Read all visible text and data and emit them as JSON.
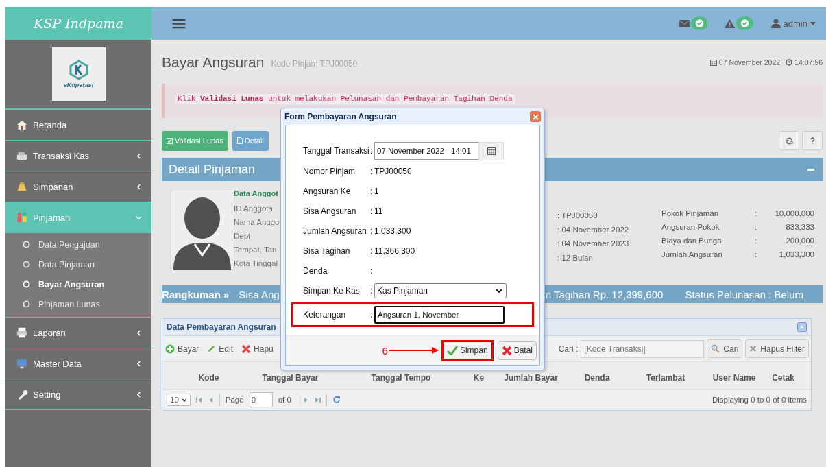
{
  "brand": "KSP Indpama",
  "logo_text": "eKoperasi",
  "topbar": {
    "user": "admin"
  },
  "sidebar": {
    "items": [
      {
        "label": "Beranda",
        "kind": "link",
        "selected": false
      },
      {
        "label": "Transaksi Kas",
        "kind": "menu",
        "selected": false,
        "expanded": false
      },
      {
        "label": "Simpanan",
        "kind": "menu",
        "selected": false,
        "expanded": false
      },
      {
        "label": "Pinjaman",
        "kind": "menu",
        "selected": true,
        "expanded": true,
        "children": [
          {
            "label": "Data Pengajuan",
            "selected": false
          },
          {
            "label": "Data Pinjaman",
            "selected": false
          },
          {
            "label": "Bayar Angsuran",
            "selected": true
          },
          {
            "label": "Pinjaman Lunas",
            "selected": false
          }
        ]
      },
      {
        "label": "Laporan",
        "kind": "menu",
        "selected": false,
        "expanded": false
      },
      {
        "label": "Master Data",
        "kind": "menu",
        "selected": false,
        "expanded": false
      },
      {
        "label": "Setting",
        "kind": "menu",
        "selected": false,
        "expanded": false
      }
    ]
  },
  "page": {
    "title": "Bayar Angsuran",
    "subtitle": "Kode Pinjam TPJ00050",
    "date": "07 November 2022",
    "time": "14:07:56"
  },
  "alert": "Klik **Validasi Lunas** untuk melakukan Pelunasan dan Pembayaran Tagihan Denda",
  "actions": [
    {
      "label": "Validasi Lunas",
      "kind": "success"
    },
    {
      "label": "Detail",
      "kind": "info"
    }
  ],
  "detail": {
    "title": "Detail Pinjaman",
    "member_heading": "Data Anggot",
    "member_labels": [
      "ID Anggota",
      "Nama Anggo",
      "Dept",
      "Tempat, Tan",
      "Kota Tinggal"
    ],
    "loan_values": [
      ": TPJ00050",
      ": 04 November 2022",
      ": 04 November 2023",
      ": 12 Bulan"
    ],
    "amounts": [
      {
        "label": "Pokok Pinjaman",
        "separator": ":",
        "value": "10,000,000"
      },
      {
        "label": "Angsuran Pokok",
        "separator": ":",
        "value": "833,333"
      },
      {
        "label": "Biaya dan Bunga",
        "separator": ":",
        "value": "200,000"
      },
      {
        "label": "Jumlah Angsuran",
        "separator": ":",
        "value": "1,033,300"
      }
    ],
    "summary": {
      "heading": "Rangkuman »",
      "left": "Sisa Ang",
      "right": "n Tagihan Rp. 12,399,600",
      "status": "Status Pelunasan : Belum"
    }
  },
  "payments": {
    "title": "Data Pembayaran Angsuran",
    "tools": [
      "Bayar",
      "Edit",
      "Hapu"
    ],
    "search_label": "Cari :",
    "search_placeholder": "[Kode Transaksi]",
    "search_button": "Cari",
    "clear_button": "Hapus Filter",
    "columns": [
      "Kode",
      "Tanggal Bayar",
      "Tanggal Tempo",
      "Ke",
      "Jumlah Bayar",
      "Denda",
      "Terlambat",
      "User Name",
      "Cetak"
    ],
    "pager": {
      "page_size": "10",
      "page_label": "Page",
      "page": "0",
      "of": "of 0",
      "info": "Displaying 0 to 0 of 0 items"
    }
  },
  "dialog": {
    "title": "Form Pembayaran Angsuran",
    "fields": [
      {
        "label": "Tanggal Transaksi",
        "separator": ":",
        "kind": "date",
        "value": "07 November 2022 - 14:01",
        "highlighted": false
      },
      {
        "label": "Nomor Pinjam",
        "separator": ":",
        "kind": "text",
        "value": "TPJ00050",
        "highlighted": false
      },
      {
        "label": "Angsuran Ke",
        "separator": ":",
        "kind": "text",
        "value": "1",
        "highlighted": false
      },
      {
        "label": "Sisa Angsuran",
        "separator": ":",
        "kind": "text",
        "value": "11",
        "highlighted": false
      },
      {
        "label": "Jumlah Angsuran",
        "separator": ":",
        "kind": "text",
        "value": "1,033,300",
        "highlighted": false
      },
      {
        "label": "Sisa Tagihan",
        "separator": ":",
        "kind": "text",
        "value": "11,366,300",
        "highlighted": false
      },
      {
        "label": "Denda",
        "separator": ":",
        "kind": "text",
        "highlighted": false
      },
      {
        "label": "Simpan Ke Kas",
        "separator": ":",
        "kind": "select",
        "value": "Kas Pinjaman",
        "highlighted": false
      },
      {
        "label": "Keterangan",
        "separator": ":",
        "kind": "input",
        "value": "Angsuran 1, November",
        "highlighted": true
      }
    ],
    "buttons": [
      {
        "label": "Simpan",
        "kind": "save",
        "highlighted": true
      },
      {
        "label": "Batal",
        "kind": "cancel",
        "highlighted": false
      }
    ],
    "annotation": "6"
  }
}
